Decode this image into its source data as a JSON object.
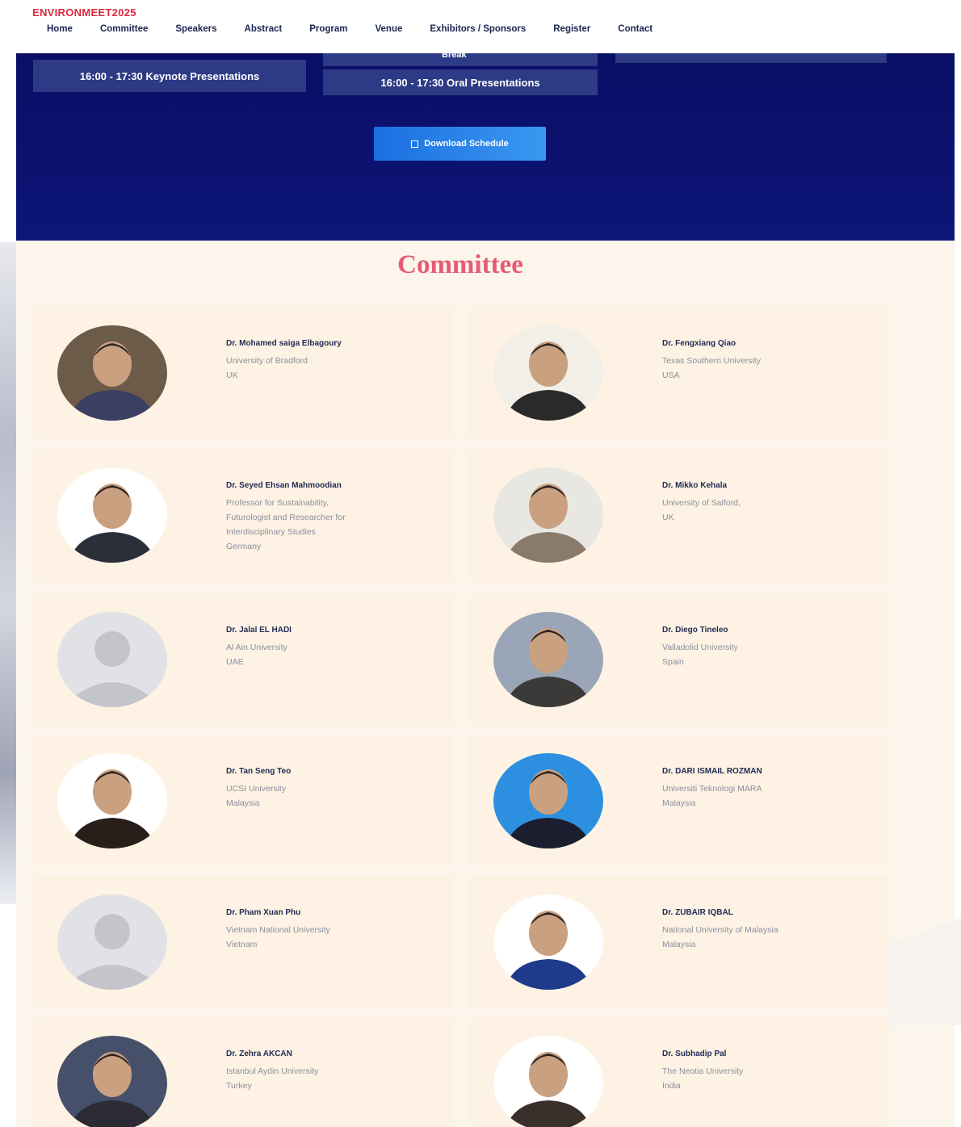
{
  "site": {
    "brand": "ENVIRONMEET2025"
  },
  "nav": {
    "items": [
      "Home",
      "Committee",
      "Speakers",
      "Abstract",
      "Program",
      "Venue",
      "Exhibitors / Sponsors",
      "Register",
      "Contact"
    ]
  },
  "hero": {
    "session_keynote": "16:00 - 17:30 Keynote Presentations",
    "session_break": "Break",
    "session_oral": "16:00 - 17:30 Oral Presentations",
    "download_label": "Download Schedule"
  },
  "committee": {
    "title": "Committee",
    "members": [
      {
        "name": "Dr. Mohamed saiga Elbagoury",
        "lines": [
          "University of Bradford",
          "UK"
        ],
        "photo": "photo"
      },
      {
        "name": "Dr. Fengxiang Qiao",
        "lines": [
          "Texas Southern University",
          "USA"
        ],
        "photo": "photo"
      },
      {
        "name": "Dr. Seyed Ehsan Mahmoodian",
        "lines": [
          "Professor for Sustainability,",
          "Futurologist and Researcher for",
          "Interdisciplinary Studies",
          "Germany"
        ],
        "photo": "photo"
      },
      {
        "name": "Dr. Mikko Kehala",
        "lines": [
          "University of Salford,",
          "UK"
        ],
        "photo": "photo"
      },
      {
        "name": "Dr. Jalal EL HADI",
        "lines": [
          "Al Ain University",
          "UAE"
        ],
        "photo": "placeholder"
      },
      {
        "name": "Dr. Diego Tineleo",
        "lines": [
          "Valladolid University",
          "Spain"
        ],
        "photo": "photo"
      },
      {
        "name": "Dr. Tan Seng Teo",
        "lines": [
          "UCSI University",
          "Malaysia"
        ],
        "photo": "photo"
      },
      {
        "name": "Dr. DARI ISMAIL ROZMAN",
        "lines": [
          "Universiti Teknologi MARA",
          "Malaysia"
        ],
        "photo": "photo"
      },
      {
        "name": "Dr. Pham Xuan Phu",
        "lines": [
          "Vietnam National University",
          "Vietnam"
        ],
        "photo": "placeholder"
      },
      {
        "name": "Dr. ZUBAIR IQBAL",
        "lines": [
          "National University of Malaysia",
          "Malaysia"
        ],
        "photo": "photo"
      },
      {
        "name": "Dr. Zehra AKCAN",
        "lines": [
          "Istanbul Aydin University",
          "Turkey"
        ],
        "photo": "photo"
      },
      {
        "name": "Dr. Subhadip Pal",
        "lines": [
          "The Neotia University",
          "India"
        ],
        "photo": "photo"
      }
    ]
  }
}
